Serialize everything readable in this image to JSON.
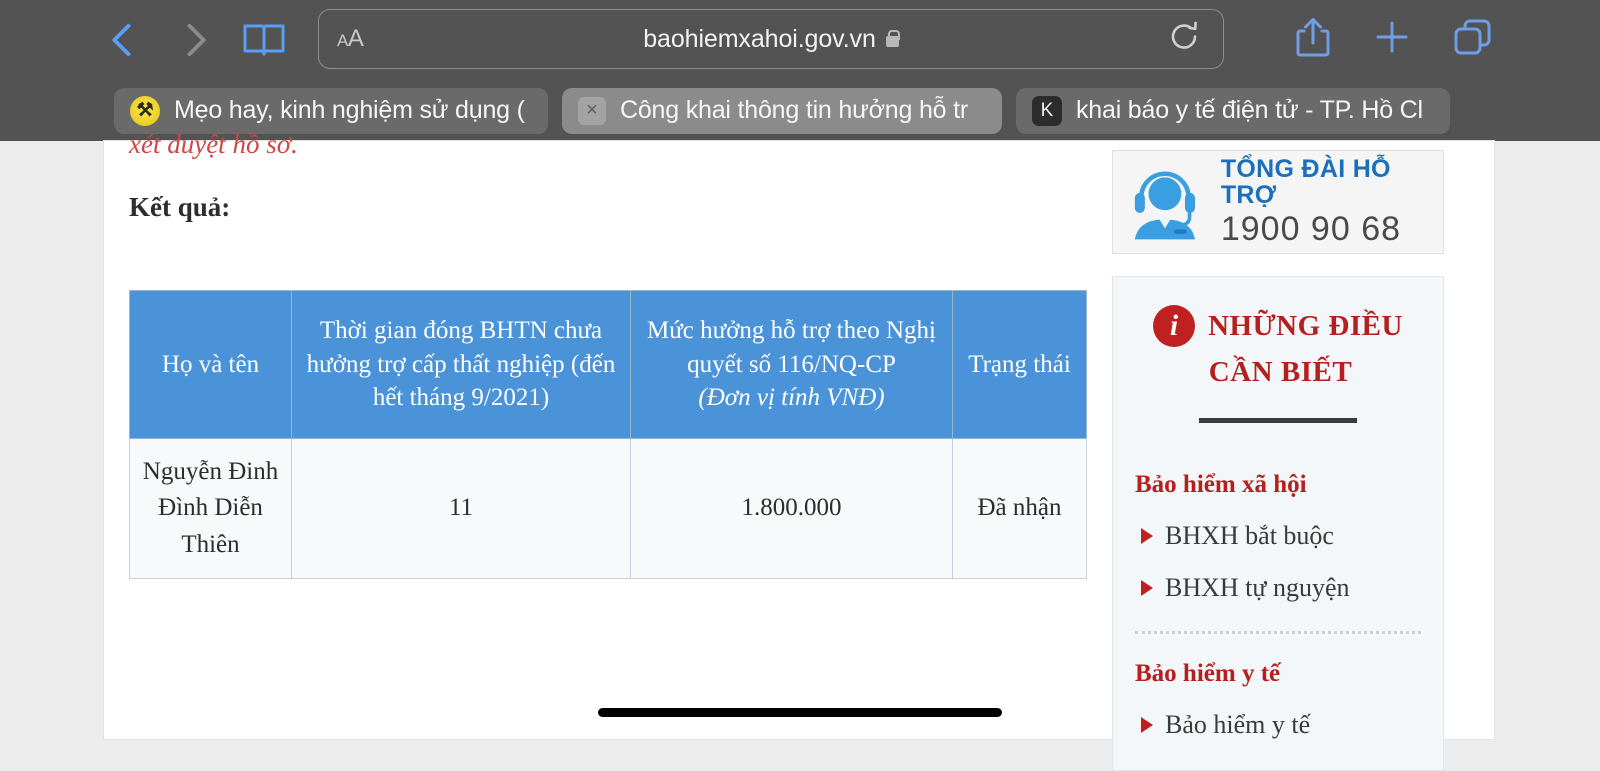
{
  "browser": {
    "back_icon": "chevron-left-icon",
    "forward_icon": "chevron-right-icon",
    "bookmarks_icon": "book-icon",
    "text_size_small": "A",
    "text_size_big": "A",
    "url": "baohiemxahoi.gov.vn",
    "lock_icon": "lock-icon",
    "reload_icon": "reload-icon",
    "share_icon": "share-icon",
    "new_tab_icon": "plus-icon",
    "tabs_overview_icon": "tabs-icon",
    "tabs": [
      {
        "title": "Mẹo hay, kinh nghiệm sử dụng (",
        "favicon": "yellow-circle-favicon",
        "favicon_glyph": "⚒",
        "active": false
      },
      {
        "title": "Công khai thông tin hưởng hỗ tr",
        "favicon": "close-icon",
        "favicon_glyph": "×",
        "active": true
      },
      {
        "title": "khai báo y tế điện tử - TP. Hồ Cl",
        "favicon": "k-square-favicon",
        "favicon_glyph": "K",
        "active": false
      }
    ]
  },
  "page": {
    "note_red": "xét duyệt hồ sơ.",
    "result_label": "Kết quả:",
    "table": {
      "headers": [
        "Họ và tên",
        "Thời gian đóng BHTN chưa hưởng trợ cấp thất nghiệp (đến hết tháng 9/2021)",
        "Mức hưởng hỗ trợ theo Nghị quyết số 116/NQ-CP",
        "Trạng thái"
      ],
      "header_3_unit": "(Đơn vị tính VNĐ)",
      "rows": [
        {
          "name": "Nguyễn Đinh Đình Diễn Thiên",
          "months": "11",
          "amount": "1.800.000",
          "status": "Đã nhận"
        }
      ]
    },
    "header_blue": "#4a93d9",
    "accent_red": "#b5201f"
  },
  "sidebar": {
    "hotline": {
      "icon": "headset-agent-icon",
      "title": "TỔNG ĐÀI HỖ TRỢ",
      "number": "1900 90 68"
    },
    "infobox": {
      "icon": "info-circle-icon",
      "icon_glyph": "i",
      "title_line1": "NHỮNG ĐIỀU",
      "title_line2": "CẦN BIẾT",
      "groups": [
        {
          "title": "Bảo hiểm xã hội",
          "links": [
            "BHXH bắt buộc",
            "BHXH tự nguyện"
          ]
        },
        {
          "title": "Bảo hiểm y tế",
          "links": [
            "Bảo hiểm y tế"
          ]
        }
      ]
    }
  }
}
